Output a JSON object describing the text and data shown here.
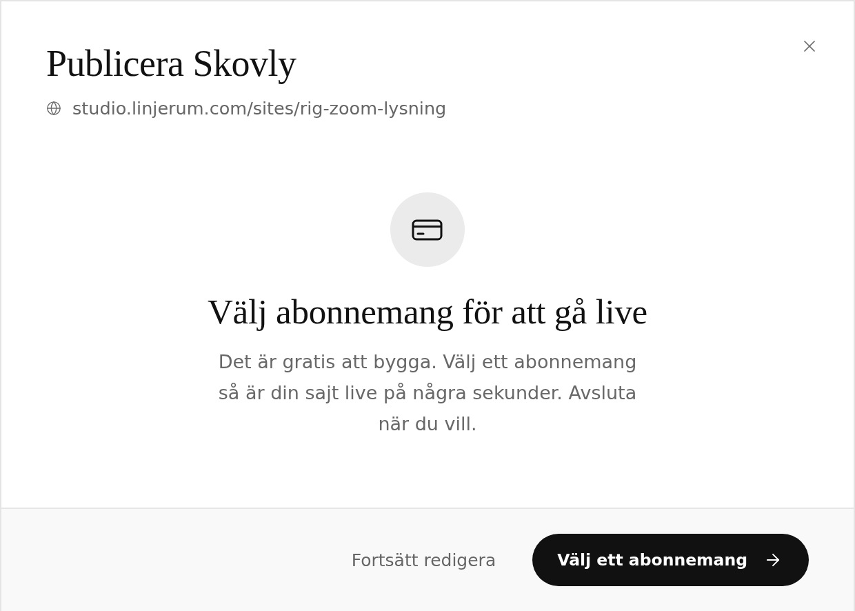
{
  "dialog": {
    "title": "Publicera Skovly",
    "url": "studio.linjerum.com/sites/rig-zoom-lysning"
  },
  "prompt": {
    "heading": "Välj abonnemang för att gå live",
    "body": "Det är gratis att bygga. Välj ett abonnemang så är din sajt live på några sekunder. Avsluta när du vill."
  },
  "footer": {
    "buttons": [
      {
        "kind": "secondary",
        "label": "Fortsätt redigera"
      },
      {
        "kind": "primary",
        "label": "Välj ett abonnemang"
      }
    ]
  }
}
